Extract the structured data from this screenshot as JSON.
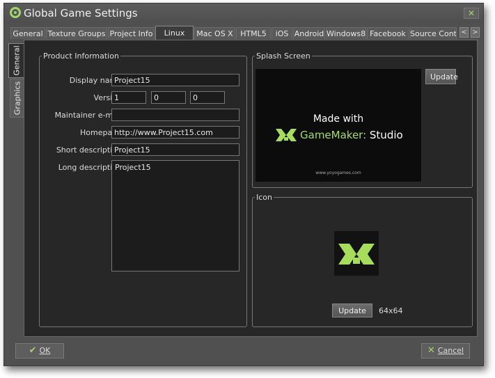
{
  "window": {
    "title": "Global Game Settings",
    "close_label": "✕"
  },
  "tabs": [
    {
      "label": "General"
    },
    {
      "label": "Texture Groups"
    },
    {
      "label": "Project Info"
    },
    {
      "label": "Linux"
    },
    {
      "label": "Mac OS X"
    },
    {
      "label": "HTML5"
    },
    {
      "label": "iOS"
    },
    {
      "label": "Android"
    },
    {
      "label": "Windows8"
    },
    {
      "label": "Facebook"
    },
    {
      "label": "Source Contro"
    }
  ],
  "active_tab": "Linux",
  "tab_scroll": {
    "left": "<",
    "right": ">"
  },
  "side_tabs": [
    {
      "label": "General"
    },
    {
      "label": "Graphics"
    }
  ],
  "product_info": {
    "legend": "Product Information",
    "display_name": {
      "label": "Display name",
      "value": "Project15"
    },
    "version": {
      "label": "Version",
      "values": [
        "1",
        "0",
        "0"
      ]
    },
    "maintainer": {
      "label": "Maintainer e-mail",
      "value": ""
    },
    "homepage": {
      "label": "Homepage",
      "value": "http://www.Project15.com"
    },
    "short_desc": {
      "label": "Short description",
      "value": "Project15"
    },
    "long_desc": {
      "label": "Long description",
      "value": "Project15"
    }
  },
  "splash": {
    "legend": "Splash Screen",
    "update_label": "Update",
    "made_with": "Made with",
    "brand_name": "GameMaker:",
    "brand_studio": " Studio",
    "url": "www.yoyogames.com"
  },
  "icon": {
    "legend": "Icon",
    "update_label": "Update",
    "size": "64x64"
  },
  "footer": {
    "ok_label": "OK",
    "cancel_label": "Cancel"
  },
  "colors": {
    "accent": "#9fd86a",
    "background": "#272727",
    "frame": "#505050"
  }
}
